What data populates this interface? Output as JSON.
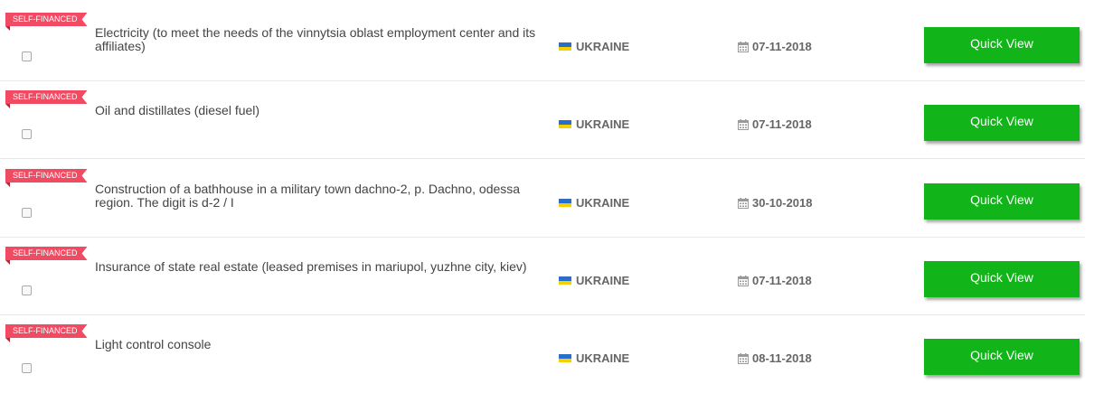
{
  "tenders": [
    {
      "badge": "SELF-FINANCED",
      "title": "Electricity (to meet the needs of the vinnytsia oblast employment center and its affiliates)",
      "country": "UKRAINE",
      "date": "07-11-2018",
      "button_label": "Quick View"
    },
    {
      "badge": "SELF-FINANCED",
      "title": "Oil and distillates (diesel fuel)",
      "country": "UKRAINE",
      "date": "07-11-2018",
      "button_label": "Quick View"
    },
    {
      "badge": "SELF-FINANCED",
      "title": "Construction of a bathhouse in a military town dachno-2, p. Dachno, odessa region. The digit is d-2 / I",
      "country": "UKRAINE",
      "date": "30-10-2018",
      "button_label": "Quick View"
    },
    {
      "badge": "SELF-FINANCED",
      "title": "Insurance of state real estate (leased premises in mariupol, yuzhne city, kiev)",
      "country": "UKRAINE",
      "date": "07-11-2018",
      "button_label": "Quick View"
    },
    {
      "badge": "SELF-FINANCED",
      "title": "Light control console",
      "country": "UKRAINE",
      "date": "08-11-2018",
      "button_label": "Quick View"
    }
  ],
  "icons": {
    "flag": "ukraine-flag-icon",
    "date": "calendar-icon"
  },
  "colors": {
    "badge": "#f04b62",
    "button": "#11b519",
    "flag_blue": "#2a6ec9",
    "flag_yellow": "#f5d000"
  }
}
